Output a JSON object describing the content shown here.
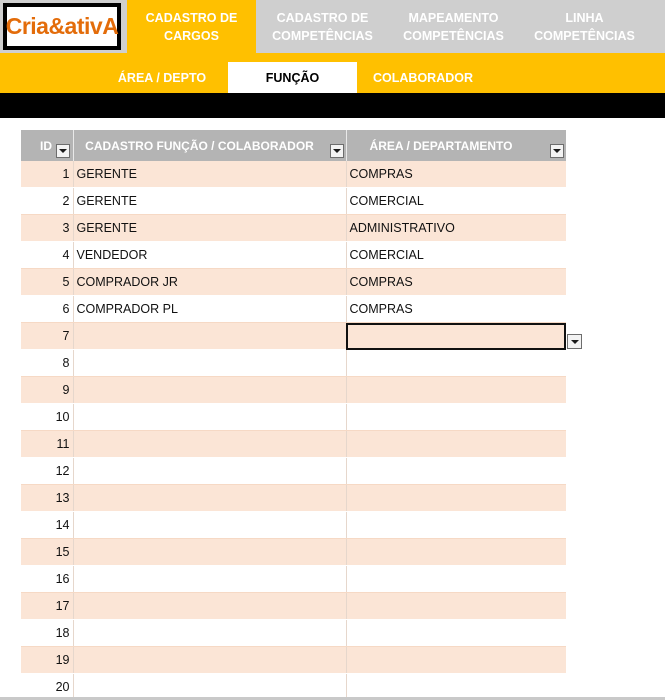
{
  "logo": {
    "text": "Cria&ativA",
    "color": "#e36c0a"
  },
  "main_tabs": [
    {
      "line1": "CADASTRO DE",
      "line2": "CARGOS",
      "active": true
    },
    {
      "line1": "CADASTRO DE",
      "line2": "COMPETÊNCIAS",
      "active": false
    },
    {
      "line1": "MAPEAMENTO",
      "line2": "COMPETÊNCIAS",
      "active": false
    },
    {
      "line1": "LINHA",
      "line2": "COMPETÊNCIAS",
      "active": false
    }
  ],
  "sub_tabs": [
    {
      "label": "ÁREA / DEPTO",
      "active": false
    },
    {
      "label": "FUNÇÃO",
      "active": true
    },
    {
      "label": "COLABORADOR",
      "active": false
    }
  ],
  "table": {
    "headers": [
      "ID",
      "CADASTRO FUNÇÃO / COLABORADOR",
      "ÁREA / DEPARTAMENTO"
    ],
    "rows": [
      {
        "id": "1",
        "funcao": "GERENTE",
        "area": "COMPRAS"
      },
      {
        "id": "2",
        "funcao": "GERENTE",
        "area": "COMERCIAL"
      },
      {
        "id": "3",
        "funcao": "GERENTE",
        "area": "ADMINISTRATIVO"
      },
      {
        "id": "4",
        "funcao": "VENDEDOR",
        "area": "COMERCIAL"
      },
      {
        "id": "5",
        "funcao": "COMPRADOR JR",
        "area": "COMPRAS"
      },
      {
        "id": "6",
        "funcao": "COMPRADOR PL",
        "area": "COMPRAS"
      },
      {
        "id": "7",
        "funcao": "",
        "area": ""
      },
      {
        "id": "8",
        "funcao": "",
        "area": ""
      },
      {
        "id": "9",
        "funcao": "",
        "area": ""
      },
      {
        "id": "10",
        "funcao": "",
        "area": ""
      },
      {
        "id": "11",
        "funcao": "",
        "area": ""
      },
      {
        "id": "12",
        "funcao": "",
        "area": ""
      },
      {
        "id": "13",
        "funcao": "",
        "area": ""
      },
      {
        "id": "14",
        "funcao": "",
        "area": ""
      },
      {
        "id": "15",
        "funcao": "",
        "area": ""
      },
      {
        "id": "16",
        "funcao": "",
        "area": ""
      },
      {
        "id": "17",
        "funcao": "",
        "area": ""
      },
      {
        "id": "18",
        "funcao": "",
        "area": ""
      },
      {
        "id": "19",
        "funcao": "",
        "area": ""
      },
      {
        "id": "20",
        "funcao": "",
        "area": ""
      }
    ]
  },
  "colors": {
    "accent": "#ffc000",
    "inactive_tab": "#cfcfcf",
    "header": "#b4b4b4",
    "row_band": "#fbe5d6"
  },
  "icons": {
    "header_filter": "filter-dropdown-icon",
    "cell_dropdown": "cell-dropdown-icon"
  }
}
